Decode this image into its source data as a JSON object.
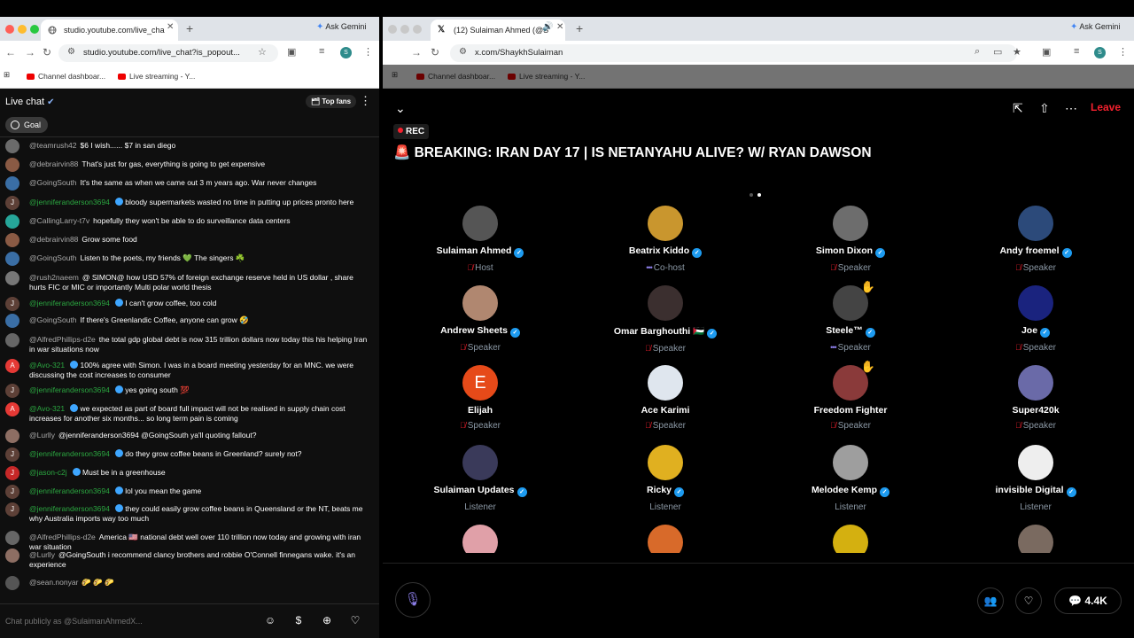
{
  "left_browser": {
    "tab_title": "studio.youtube.com/live_cha",
    "ask_gemini": "Ask Gemini",
    "url": "studio.youtube.com/live_chat?is_popout...",
    "profile_initial": "S",
    "bookmarks": [
      "Channel dashboar...",
      "Live streaming - Y..."
    ]
  },
  "chat": {
    "title": "Live chat",
    "top_fans": "Top fans",
    "goal": "Goal",
    "input_placeholder": "Chat publicly as @SulaimanAhmedX...",
    "messages": [
      {
        "user": "@teamrush42",
        "text": "$6 I wish...... $7 in san diego",
        "member": false,
        "av": "#6b6b6b",
        "init": ""
      },
      {
        "user": "@debrairvin88",
        "text": "That's just for gas, everything is going to get expensive",
        "member": false,
        "av": "#8a5a44",
        "init": ""
      },
      {
        "user": "@GoingSouth",
        "text": "It's the same as when we came out 3 m years ago. War never changes",
        "member": false,
        "av": "#3a6ea5",
        "init": ""
      },
      {
        "user": "@jenniferanderson3694",
        "text": "bloody supermarkets wasted no time in putting up prices pronto here",
        "member": true,
        "av": "#5d4037",
        "init": "J"
      },
      {
        "user": "@CallingLarry-t7v",
        "text": "hopefully they won't be able to do surveillance data centers",
        "member": false,
        "av": "#26a69a",
        "init": ""
      },
      {
        "user": "@debrairvin88",
        "text": "Grow some food",
        "member": false,
        "av": "#8a5a44",
        "init": ""
      },
      {
        "user": "@GoingSouth",
        "text": "Listen to the poets, my friends 💚 The singers ☘️",
        "member": false,
        "av": "#3a6ea5",
        "init": ""
      },
      {
        "user": "@rush2naeem",
        "text": "@ SIMON@ how USD 57% of foreign exchange reserve held in US dollar , share hurts FIC or MIC or importantly Multi polar world thesis",
        "member": false,
        "av": "#777",
        "init": ""
      },
      {
        "user": "@jenniferanderson3694",
        "text": "I can't grow coffee, too cold",
        "member": true,
        "av": "#5d4037",
        "init": "J"
      },
      {
        "user": "@GoingSouth",
        "text": "If there's Greenlandic Coffee, anyone can grow 🤣",
        "member": false,
        "av": "#3a6ea5",
        "init": ""
      },
      {
        "user": "@AlfredPhillips-d2e",
        "text": "the total gdp global debt is now 315 trillion dollars now today this his helping Iran in war situations now",
        "member": false,
        "av": "#666",
        "init": ""
      },
      {
        "user": "@Avo-321",
        "text": "100% agree with Simon. I was in a board meeting yesterday for an MNC. we were discussing the cost increases to consumer",
        "member": true,
        "av": "#e53935",
        "init": "A"
      },
      {
        "user": "@jenniferanderson3694",
        "text": "yes going south 💯",
        "member": true,
        "av": "#5d4037",
        "init": "J"
      },
      {
        "user": "@Avo-321",
        "text": "we expected as part of board full impact will not be realised in supply chain cost increases for another six months... so long term pain is coming",
        "member": true,
        "av": "#e53935",
        "init": "A"
      },
      {
        "user": "@Lurlly",
        "text": "@jenniferanderson3694 @GoingSouth ya'll quoting fallout?",
        "member": false,
        "av": "#8d6e63",
        "init": ""
      },
      {
        "user": "@jenniferanderson3694",
        "text": "do they grow coffee beans in Greenland? surely not?",
        "member": true,
        "av": "#5d4037",
        "init": "J"
      },
      {
        "user": "@jason-c2j",
        "text": "Must be in a greenhouse",
        "member": true,
        "av": "#c62828",
        "init": "J"
      },
      {
        "user": "@jenniferanderson3694",
        "text": "lol you mean the game",
        "member": true,
        "av": "#5d4037",
        "init": "J"
      },
      {
        "user": "@jenniferanderson3694",
        "text": "they could easily grow coffee beans in Queensland or the NT, beats me why Australia imports way too much",
        "member": true,
        "av": "#5d4037",
        "init": "J"
      },
      {
        "user": "@AlfredPhillips-d2e",
        "text": "America 🇺🇸 national debt well over 110 trillion now today and growing with iran war situation",
        "member": false,
        "av": "#666",
        "init": ""
      },
      {
        "user": "@Lurlly",
        "text": "@GoingSouth i recommend clancy brothers and robbie O'Connell finnegans wake. it's an experience",
        "member": false,
        "av": "#8d6e63",
        "init": ""
      },
      {
        "user": "@sean.nonyar",
        "text": "🌮 🌮 🌮",
        "member": false,
        "av": "#555",
        "init": ""
      }
    ]
  },
  "right_browser": {
    "tab_title": "(12) Sulaiman Ahmed (@S",
    "ask_gemini": "Ask Gemini",
    "url": "x.com/ShaykhSulaiman",
    "profile_initial": "S",
    "bookmarks": [
      "Channel dashboar...",
      "Live streaming - Y..."
    ]
  },
  "space": {
    "leave": "Leave",
    "rec": "REC",
    "title": "🚨 BREAKING: IRAN DAY 17 | IS NETANYAHU ALIVE? W/ RYAN DAWSON",
    "listener_count": "4.4K",
    "participants": [
      {
        "name": "Sulaiman Ahmed",
        "role": "Host",
        "verified": true,
        "muted": true,
        "speaking": false,
        "hand": false,
        "av": "#555",
        "init": ""
      },
      {
        "name": "Beatrix Kiddo",
        "role": "Co-host",
        "verified": true,
        "muted": false,
        "speaking": true,
        "hand": false,
        "av": "#c9962e",
        "init": ""
      },
      {
        "name": "Simon Dixon",
        "role": "Speaker",
        "verified": true,
        "muted": true,
        "speaking": false,
        "hand": false,
        "av": "#6d6d6d",
        "init": ""
      },
      {
        "name": "Andy froemel",
        "role": "Speaker",
        "verified": true,
        "muted": true,
        "speaking": false,
        "hand": false,
        "av": "#2c4a7a",
        "init": ""
      },
      {
        "name": "Andrew Sheets",
        "role": "Speaker",
        "verified": true,
        "muted": true,
        "speaking": false,
        "hand": false,
        "av": "#b08770",
        "init": ""
      },
      {
        "name": "Omar Barghouthi 🇵🇸",
        "role": "Speaker",
        "verified": true,
        "muted": true,
        "speaking": false,
        "hand": false,
        "av": "#3b2f2f",
        "init": ""
      },
      {
        "name": "Steele™",
        "role": "Speaker",
        "verified": true,
        "muted": false,
        "speaking": true,
        "hand": true,
        "av": "#444",
        "init": ""
      },
      {
        "name": "Joe",
        "role": "Speaker",
        "verified": true,
        "muted": true,
        "speaking": false,
        "hand": false,
        "av": "#1a237e",
        "init": ""
      },
      {
        "name": "Elijah",
        "role": "Speaker",
        "verified": false,
        "muted": true,
        "speaking": false,
        "hand": false,
        "av": "#e64a19",
        "init": "E"
      },
      {
        "name": "Ace Karimi",
        "role": "Speaker",
        "verified": false,
        "muted": true,
        "speaking": false,
        "hand": false,
        "av": "#dfe6ee",
        "init": ""
      },
      {
        "name": "Freedom Fighter",
        "role": "Speaker",
        "verified": false,
        "muted": true,
        "speaking": false,
        "hand": true,
        "av": "#8a3a3a",
        "init": ""
      },
      {
        "name": "Super420k",
        "role": "Speaker",
        "verified": false,
        "muted": true,
        "speaking": false,
        "hand": false,
        "av": "#6a6aa8",
        "init": ""
      },
      {
        "name": "Sulaiman Updates",
        "role": "Listener",
        "verified": true,
        "muted": false,
        "speaking": false,
        "hand": false,
        "av": "#3a3a5a",
        "init": ""
      },
      {
        "name": "Ricky",
        "role": "Listener",
        "verified": true,
        "muted": false,
        "speaking": false,
        "hand": false,
        "av": "#e0b020",
        "init": ""
      },
      {
        "name": "Melodee Kemp",
        "role": "Listener",
        "verified": true,
        "muted": false,
        "speaking": false,
        "hand": false,
        "av": "#9e9e9e",
        "init": ""
      },
      {
        "name": "invisible Digital",
        "role": "Listener",
        "verified": true,
        "muted": false,
        "speaking": false,
        "hand": false,
        "av": "#eeeeee",
        "init": ""
      }
    ],
    "partial_avatars": [
      "#e0a0a8",
      "#d86a2a",
      "#d4b010",
      "#7a6a60"
    ]
  }
}
